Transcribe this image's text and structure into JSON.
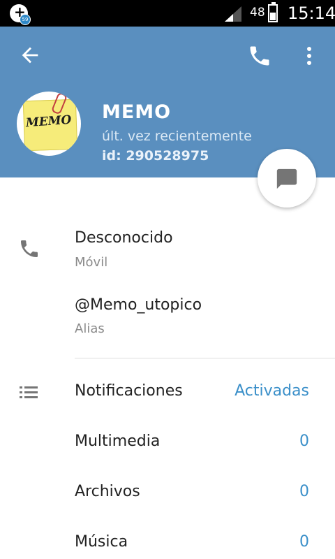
{
  "status_bar": {
    "notification_badge": "59",
    "battery_percent": "48",
    "time": "15:14"
  },
  "header": {
    "background_color": "#5a8fbf",
    "avatar_text": "MEMO",
    "name": "MEMO",
    "last_seen": "últ. vez recientemente",
    "user_id": "id: 290528975"
  },
  "contact": {
    "phone_value": "Desconocido",
    "phone_label": "Móvil",
    "username_value": "@Memo_utopico",
    "username_label": "Alias"
  },
  "settings": [
    {
      "label": "Notificaciones",
      "value": "Activadas"
    },
    {
      "label": "Multimedia",
      "value": "0"
    },
    {
      "label": "Archivos",
      "value": "0"
    },
    {
      "label": "Música",
      "value": "0"
    }
  ],
  "colors": {
    "accent": "#3a8fc9",
    "icon_gray": "#757575"
  }
}
